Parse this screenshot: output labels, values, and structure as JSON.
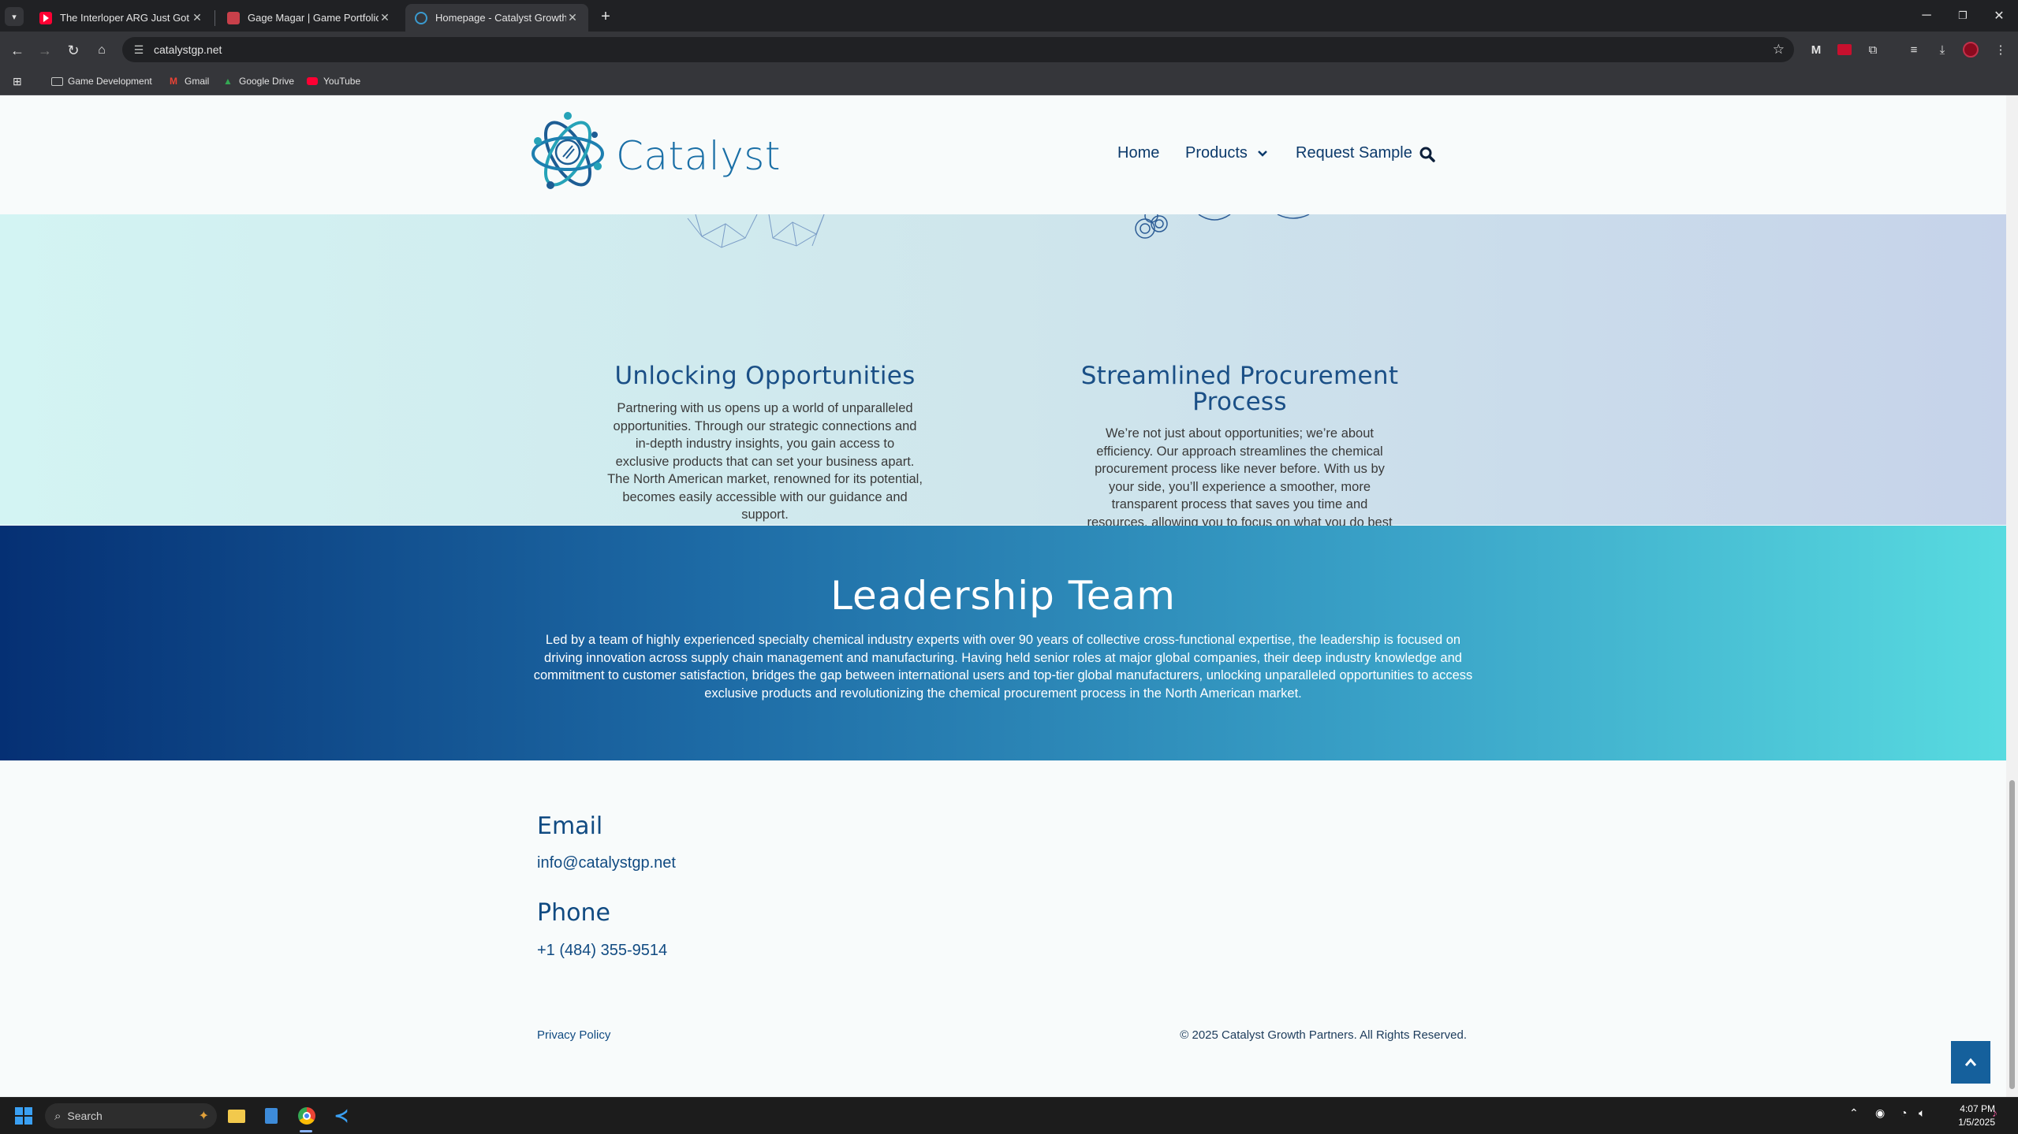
{
  "browser": {
    "tabs": [
      {
        "title": "The Interloper ARG Just Got Mu",
        "favicon_color": "#ff0033",
        "active": false
      },
      {
        "title": "Gage Magar | Game Portfolio",
        "favicon_color": "#c8404a",
        "active": false
      },
      {
        "title": "Homepage - Catalyst Growth P",
        "favicon_color": "#3a9bd0",
        "active": true
      }
    ],
    "new_tab_glyph": "+",
    "url": "catalystgp.net",
    "bookmarks": [
      {
        "label": "Game Development",
        "icon": "folder-icon"
      },
      {
        "label": "Gmail",
        "icon": "gmail-icon"
      },
      {
        "label": "Google Drive",
        "icon": "google-drive-icon"
      },
      {
        "label": "YouTube",
        "icon": "youtube-icon"
      }
    ]
  },
  "site": {
    "logo_text": "Catalyst",
    "nav": {
      "home": "Home",
      "products": "Products",
      "request_sample": "Request Sample"
    },
    "features": [
      {
        "title": "Unlocking Opportunities",
        "body": "Partnering with us opens up a world of unparalleled opportunities. Through our strategic connections and in-depth industry insights, you gain access to exclusive products that can set your business apart. The North American market, renowned for its potential, becomes easily accessible with our guidance and support."
      },
      {
        "title": "Streamlined Procurement Process",
        "body": "We’re not just about opportunities; we’re about efficiency. Our approach streamlines the chemical procurement process like never before. With us by your side, you’ll experience a smoother, more transparent process that saves you time and resources, allowing you to focus on what you do best – innovation and production."
      }
    ],
    "leadership": {
      "title": "Leadership Team",
      "body": "Led by a team of highly experienced specialty chemical industry experts with over 90 years of collective cross-functional expertise, the leadership is focused on driving innovation across supply chain management and manufacturing. Having held senior roles at major global companies, their deep industry knowledge and commitment to customer satisfaction, bridges the gap between international users and top-tier global manufacturers, unlocking unparalleled opportunities to access exclusive products and revolutionizing the chemical procurement process in the North American market."
    },
    "contact": {
      "email_heading": "Email",
      "email": "info@catalystgp.net",
      "phone_heading": "Phone",
      "phone": "+1 (484) 355-9514"
    },
    "footer": {
      "privacy": "Privacy Policy",
      "copyright": "© 2025 Catalyst Growth Partners. All Rights Reserved."
    }
  },
  "taskbar": {
    "search_placeholder": "Search",
    "time": "4:07 PM",
    "date": "1/5/2025"
  },
  "colors": {
    "brand_blue": "#114b82",
    "leadership_gradient_start": "#053074",
    "leadership_gradient_end": "#58dbe0"
  }
}
